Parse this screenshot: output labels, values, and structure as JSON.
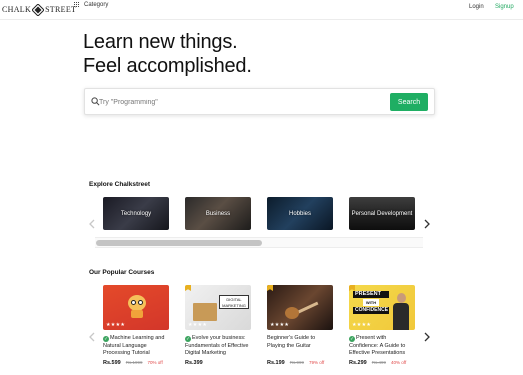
{
  "header": {
    "logo_left": "CHALK",
    "logo_right": "STREET",
    "category_label": "Category",
    "login_label": "Login",
    "signup_label": "Signup"
  },
  "hero": {
    "line1": "Learn new things.",
    "line2": "Feel accomplished."
  },
  "search": {
    "placeholder": "Try \"Programming\"",
    "button_label": "Search"
  },
  "explore": {
    "title": "Explore Chalkstreet",
    "categories": [
      {
        "label": "Technology"
      },
      {
        "label": "Business"
      },
      {
        "label": "Hobbies"
      },
      {
        "label": "Personal Development"
      }
    ]
  },
  "popular": {
    "title": "Our Popular Courses",
    "courses": [
      {
        "title": "Machine Learning and Natural Language Processing Tutorial",
        "rating": "★★★★",
        "price": "Rs.599",
        "original_price": "Rs.1999",
        "discount": "70% off"
      },
      {
        "title": "Evolve your business: Fundamentals of Effective Digital Marketing",
        "rating": "★★★★",
        "price": "Rs.399",
        "original_price": "",
        "discount": ""
      },
      {
        "title": "Beginner's Guide to Playing the Guitar",
        "rating": "★★★★",
        "price": "Rs.199",
        "original_price": "Rs.999",
        "discount": "79% off"
      },
      {
        "title": "Present with Confidence: A Guide to Effective Presentations",
        "rating": "★★★★",
        "price": "Rs.299",
        "original_price": "Rs.499",
        "discount": "40% off"
      }
    ],
    "thumb_text": {
      "digital_marketing": "DIGITAL MARKETING",
      "present": "PRESENT",
      "with": "WITH",
      "confidence": "CONFIDENCE"
    }
  },
  "colors": {
    "accent": "#1fae63",
    "discount": "#e04747",
    "verified": "#3aa35e"
  },
  "icons": {
    "search": "search-icon",
    "grid": "grid-icon",
    "prev": "chevron-left-icon",
    "next": "chevron-right-icon",
    "verified": "check-badge-icon",
    "bookmark": "bookmark-icon"
  }
}
